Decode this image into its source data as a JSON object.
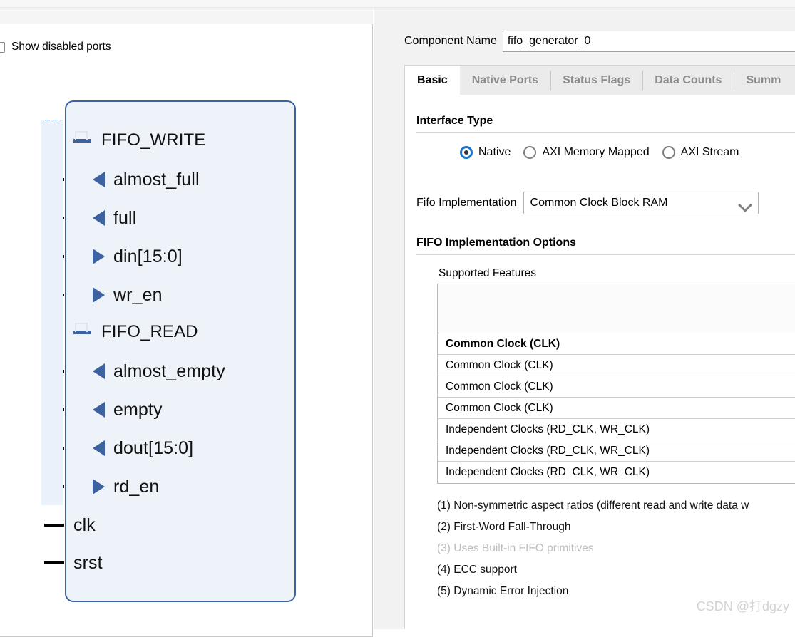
{
  "left_panel": {
    "show_disabled_ports_label": "Show disabled ports",
    "show_disabled_ports_checked": false,
    "symbol": {
      "border_color": "#3d62a0",
      "fill_color": "#eef3fa",
      "ports": [
        {
          "name": "FIFO_WRITE",
          "kind": "group",
          "pin": "bus"
        },
        {
          "name": "almost_full",
          "kind": "output",
          "pin": "line"
        },
        {
          "name": "full",
          "kind": "output",
          "pin": "line"
        },
        {
          "name": "din[15:0]",
          "kind": "input",
          "pin": "line"
        },
        {
          "name": "wr_en",
          "kind": "input",
          "pin": "line"
        },
        {
          "name": "FIFO_READ",
          "kind": "group",
          "pin": "bus"
        },
        {
          "name": "almost_empty",
          "kind": "output",
          "pin": "line"
        },
        {
          "name": "empty",
          "kind": "output",
          "pin": "line"
        },
        {
          "name": "dout[15:0]",
          "kind": "output",
          "pin": "line"
        },
        {
          "name": "rd_en",
          "kind": "input",
          "pin": "line"
        },
        {
          "name": "clk",
          "kind": "plain",
          "pin": "line"
        },
        {
          "name": "srst",
          "kind": "plain",
          "pin": "line"
        }
      ]
    }
  },
  "right_panel": {
    "component_name_label": "Component Name",
    "component_name_value": "fifo_generator_0",
    "tabs": [
      {
        "label": "Basic",
        "active": true
      },
      {
        "label": "Native Ports",
        "active": false
      },
      {
        "label": "Status Flags",
        "active": false
      },
      {
        "label": "Data Counts",
        "active": false
      },
      {
        "label": "Summ",
        "active": false
      }
    ],
    "interface_type": {
      "title": "Interface Type",
      "options": [
        {
          "label": "Native",
          "checked": true
        },
        {
          "label": "AXI Memory Mapped",
          "checked": false
        },
        {
          "label": "AXI Stream",
          "checked": false
        }
      ]
    },
    "fifo_implementation": {
      "label": "Fifo Implementation",
      "value": "Common Clock Block RAM",
      "chevron_icon": "chevron-down-icon"
    },
    "fifo_implementation_options": {
      "title": "FIFO Implementation Options",
      "supported_features_label": "Supported Features",
      "rows": [
        {
          "text": "Common Clock (CLK)",
          "bold": true
        },
        {
          "text": "Common Clock (CLK)",
          "bold": false
        },
        {
          "text": "Common Clock (CLK)",
          "bold": false
        },
        {
          "text": "Common Clock (CLK)",
          "bold": false
        },
        {
          "text": "Independent Clocks (RD_CLK, WR_CLK)",
          "bold": false
        },
        {
          "text": "Independent Clocks (RD_CLK, WR_CLK)",
          "bold": false
        },
        {
          "text": "Independent Clocks (RD_CLK, WR_CLK)",
          "bold": false
        }
      ],
      "footnotes": [
        {
          "text": "(1) Non-symmetric aspect ratios (different read and write data w",
          "disabled": false
        },
        {
          "text": "(2) First-Word Fall-Through",
          "disabled": false
        },
        {
          "text": "(3) Uses Built-in FIFO primitives",
          "disabled": true
        },
        {
          "text": "(4) ECC support",
          "disabled": false
        },
        {
          "text": "(5) Dynamic Error Injection",
          "disabled": false
        }
      ]
    }
  },
  "watermark": "CSDN @打dgzy"
}
